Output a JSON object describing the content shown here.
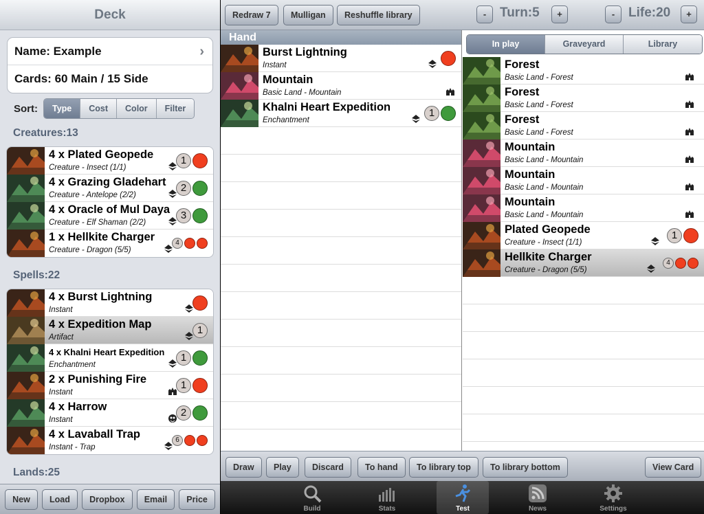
{
  "deck": {
    "title": "Deck",
    "name_row": "Name: Example",
    "cards_row": "Cards: 60 Main  / 15 Side",
    "sort_label": "Sort:",
    "sort_options": [
      "Type",
      "Cost",
      "Color",
      "Filter"
    ],
    "selected_sort": "Type",
    "sections": [
      {
        "title": "Creatures:13",
        "cards": [
          {
            "name": "4 x Plated Geopede",
            "type": "Creature  - Insect (1/1)",
            "set": "zendikar",
            "mana": [
              "1",
              "R"
            ]
          },
          {
            "name": "4 x Grazing Gladehart",
            "type": "Creature  - Antelope (2/2)",
            "set": "zendikar",
            "mana": [
              "2",
              "G"
            ]
          },
          {
            "name": "4 x Oracle of Mul Daya",
            "type": "Creature  - Elf Shaman (2/2)",
            "set": "zendikar",
            "mana": [
              "3",
              "G"
            ]
          },
          {
            "name": "1 x Hellkite Charger",
            "type": "Creature  - Dragon (5/5)",
            "set": "zendikar",
            "mana": [
              "4",
              "R",
              "R"
            ]
          }
        ]
      },
      {
        "title": "Spells:22",
        "cards": [
          {
            "name": "4 x Burst Lightning",
            "type": "Instant",
            "set": "zendikar",
            "mana": [
              "R"
            ]
          },
          {
            "name": "4 x Expedition Map",
            "type": "Artifact",
            "set": "zendikar",
            "mana": [
              "1"
            ],
            "highlighted": true
          },
          {
            "name": "4 x Khalni Heart Expedition",
            "type": "Enchantment",
            "set": "zendikar",
            "mana": [
              "1",
              "G"
            ]
          },
          {
            "name": "2 x Punishing Fire",
            "type": "Instant",
            "set": "castle",
            "mana": [
              "1",
              "R"
            ]
          },
          {
            "name": "4 x Harrow",
            "type": "Instant",
            "set": "mask",
            "mana": [
              "2",
              "G"
            ]
          },
          {
            "name": "4 x Lavaball Trap",
            "type": "Instant  - Trap",
            "set": "zendikar",
            "mana": [
              "6",
              "R",
              "R"
            ]
          }
        ]
      },
      {
        "title": "Lands:25"
      }
    ],
    "bottom_buttons": [
      "New",
      "Load",
      "Dropbox",
      "Email",
      "Price"
    ]
  },
  "toolbar": {
    "redraw": "Redraw 7",
    "mulligan": "Mulligan",
    "reshuffle": "Reshuffle library",
    "minus": "-",
    "plus": "+",
    "turn": "Turn:5",
    "life": "Life:20"
  },
  "hand": {
    "header": "Hand",
    "cards": [
      {
        "name": "Burst Lightning",
        "type": "Instant",
        "set": "zendikar",
        "mana": [
          "R"
        ]
      },
      {
        "name": "Mountain",
        "type": "Basic Land  - Mountain",
        "set": "castle",
        "mana": []
      },
      {
        "name": "Khalni Heart Expedition",
        "type": "Enchantment",
        "set": "zendikar",
        "mana": [
          "1",
          "G"
        ]
      }
    ]
  },
  "zones": {
    "tabs": [
      "In play",
      "Graveyard",
      "Library"
    ],
    "selected": "In play",
    "in_play": [
      {
        "name": "Forest",
        "type": "Basic Land  - Forest",
        "set": "castle",
        "mana": []
      },
      {
        "name": "Forest",
        "type": "Basic Land  - Forest",
        "set": "castle",
        "mana": []
      },
      {
        "name": "Forest",
        "type": "Basic Land  - Forest",
        "set": "castle",
        "mana": []
      },
      {
        "name": "Mountain",
        "type": "Basic Land  - Mountain",
        "set": "castle",
        "mana": []
      },
      {
        "name": "Mountain",
        "type": "Basic Land  - Mountain",
        "set": "castle",
        "mana": []
      },
      {
        "name": "Mountain",
        "type": "Basic Land  - Mountain",
        "set": "castle",
        "mana": []
      },
      {
        "name": "Plated Geopede",
        "type": "Creature  - Insect (1/1)",
        "set": "zendikar",
        "mana": [
          "1",
          "R"
        ]
      },
      {
        "name": "Hellkite Charger",
        "type": "Creature  - Dragon (5/5)",
        "set": "zendikar",
        "mana": [
          "4",
          "R",
          "R"
        ],
        "highlighted": true
      }
    ]
  },
  "actions": [
    "Draw",
    "Play",
    "Discard",
    "To hand",
    "To library top",
    "To library bottom",
    "View Card"
  ],
  "tabbar": [
    {
      "label": "Build",
      "icon": "magnifier-icon"
    },
    {
      "label": "Stats",
      "icon": "bar-chart-icon"
    },
    {
      "label": "Test",
      "icon": "running-man-icon",
      "selected": true
    },
    {
      "label": "News",
      "icon": "rss-icon"
    },
    {
      "label": "Settings",
      "icon": "gear-icon"
    }
  ],
  "colors": {
    "red_mana": "#f03f1f",
    "green_mana": "#3f9a3c",
    "generic_mana": "#d8d0cc"
  }
}
